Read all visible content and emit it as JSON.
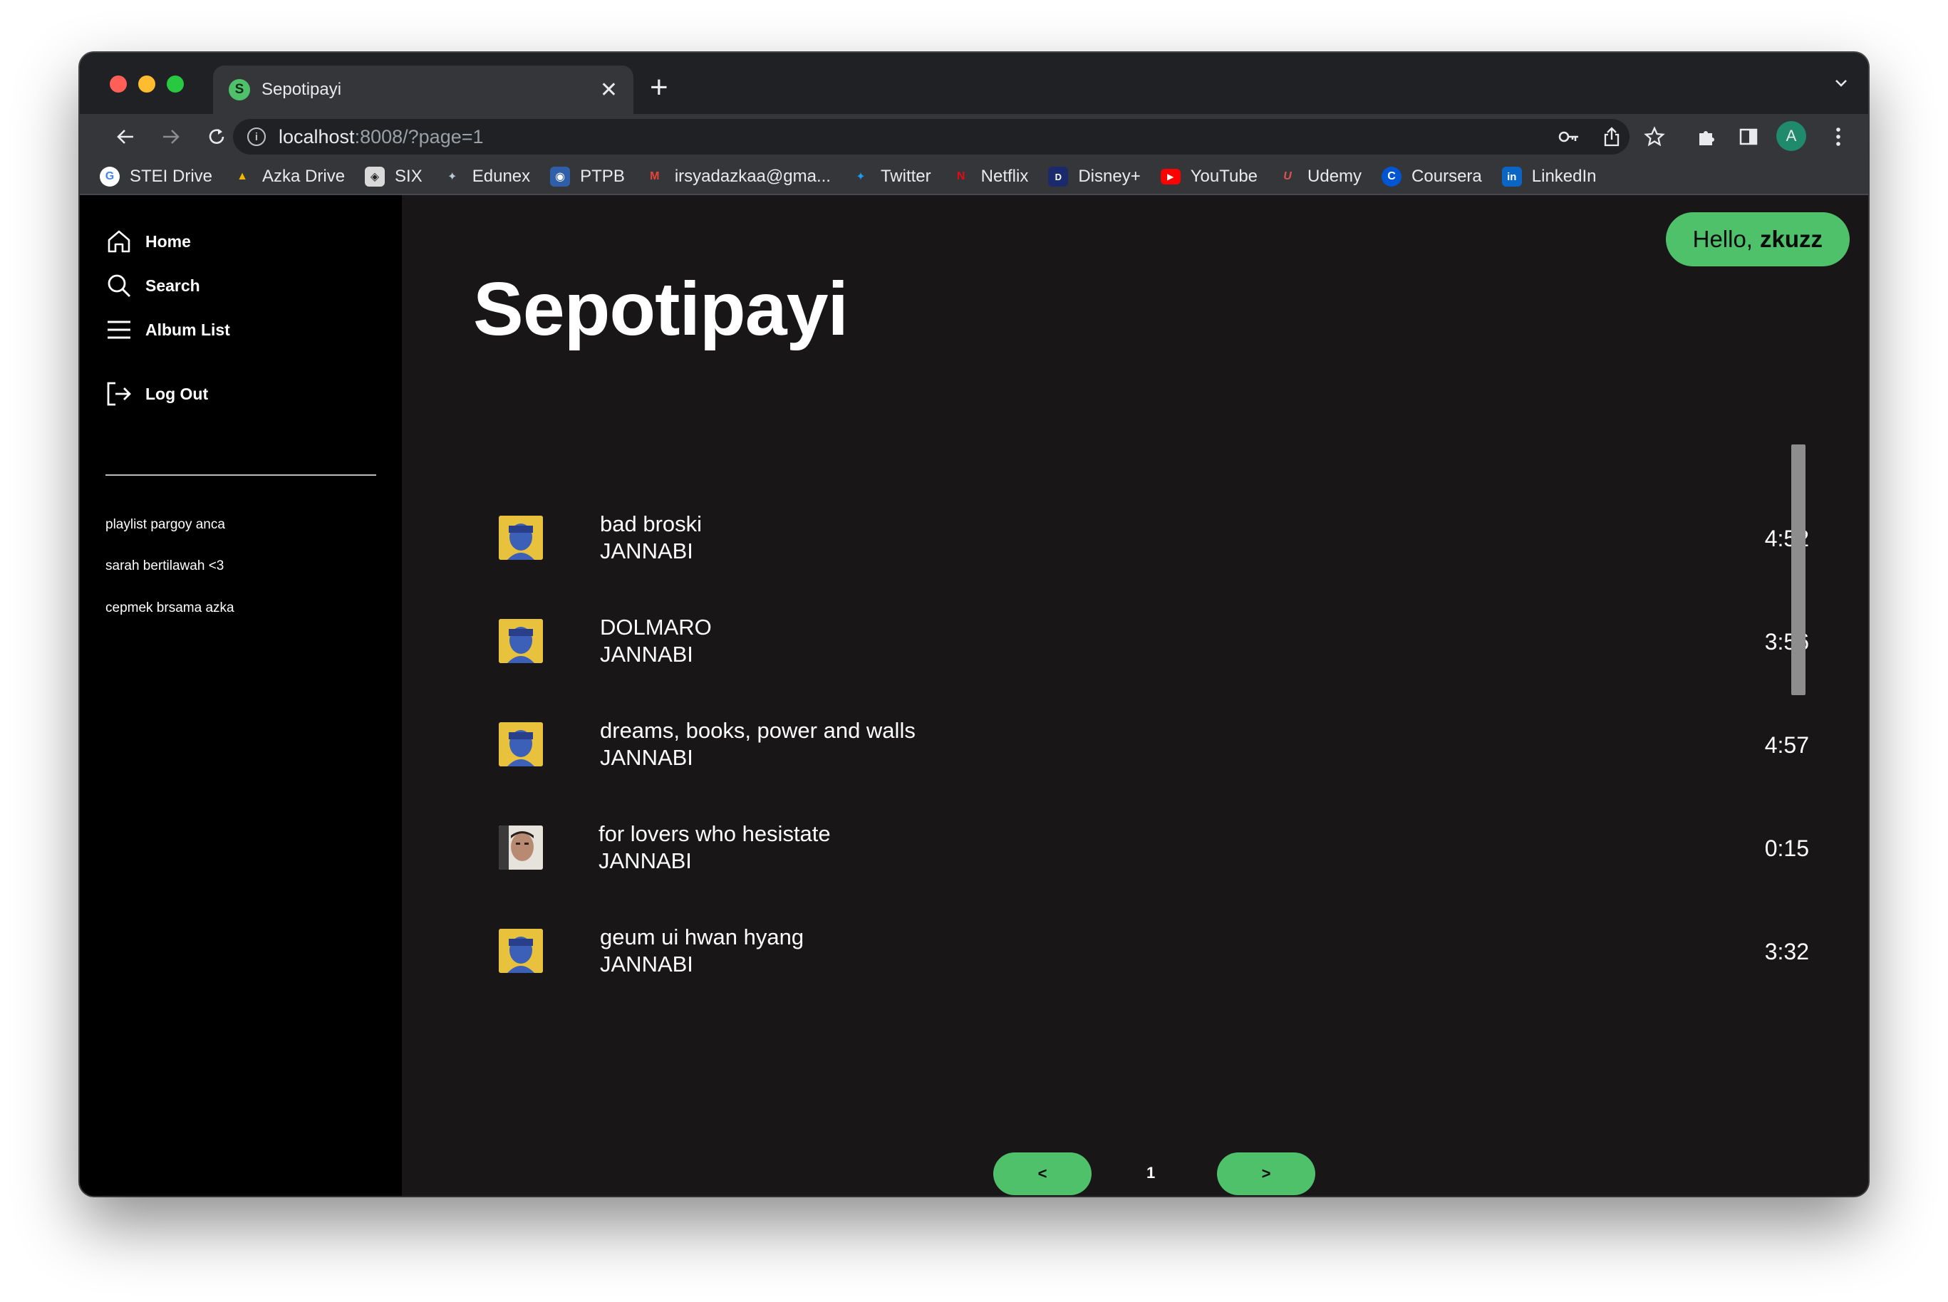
{
  "browser": {
    "tab_title": "Sepotipayi",
    "tab_favicon_letter": "S",
    "tab_close": "✕",
    "new_tab": "+",
    "url_host": "localhost",
    "url_rest": ":8008/?page=1",
    "profile_letter": "A",
    "bookmarks": [
      {
        "label": "STEI Drive",
        "icon": "google-icon",
        "color": "#4285f4",
        "glyph": "G"
      },
      {
        "label": "Azka Drive",
        "icon": "google-drive-icon",
        "color": "#1fa463",
        "glyph": "▲"
      },
      {
        "label": "SIX",
        "icon": "six-icon",
        "color": "#9e9e9e",
        "glyph": "◈"
      },
      {
        "label": "Edunex",
        "icon": "edunex-icon",
        "color": "#6a8caf",
        "glyph": "✦"
      },
      {
        "label": "PTPB",
        "icon": "ptpb-icon",
        "color": "#2f5fa8",
        "glyph": "◉"
      },
      {
        "label": "irsyadazkaa@gma...",
        "icon": "gmail-icon",
        "color": "#ea4335",
        "glyph": "M"
      },
      {
        "label": "Twitter",
        "icon": "twitter-icon",
        "color": "#1d9bf0",
        "glyph": "✦"
      },
      {
        "label": "Netflix",
        "icon": "netflix-icon",
        "color": "#e50914",
        "glyph": "N"
      },
      {
        "label": "Disney+",
        "icon": "disney-icon",
        "color": "#1a2a6c",
        "glyph": "D"
      },
      {
        "label": "YouTube",
        "icon": "youtube-icon",
        "color": "#ff0000",
        "glyph": "▶"
      },
      {
        "label": "Udemy",
        "icon": "udemy-icon",
        "color": "#a435f0",
        "glyph": "U"
      },
      {
        "label": "Coursera",
        "icon": "coursera-icon",
        "color": "#0056d2",
        "glyph": "C"
      },
      {
        "label": "LinkedIn",
        "icon": "linkedin-icon",
        "color": "#0a66c2",
        "glyph": "in"
      }
    ]
  },
  "sidebar": {
    "nav": [
      {
        "label": "Home",
        "icon": "home-icon"
      },
      {
        "label": "Search",
        "icon": "search-icon"
      },
      {
        "label": "Album List",
        "icon": "menu-icon"
      },
      {
        "label": "Log Out",
        "icon": "logout-icon"
      }
    ],
    "playlists": [
      "playlist pargoy anca",
      "sarah bertilawah <3",
      "cepmek brsama azka"
    ]
  },
  "header": {
    "greeting": "Hello,",
    "username": "zkuzz",
    "title": "Sepotipayi"
  },
  "songs": [
    {
      "title": "bad broski",
      "artist": "JANNABI",
      "duration": "4:52",
      "thumb": "album-art-jannabi"
    },
    {
      "title": "DOLMARO",
      "artist": "JANNABI",
      "duration": "3:56",
      "thumb": "album-art-jannabi"
    },
    {
      "title": "dreams, books, power and walls",
      "artist": "JANNABI",
      "duration": "4:57",
      "thumb": "album-art-jannabi"
    },
    {
      "title": "for lovers who hesistate",
      "artist": "JANNABI",
      "duration": "0:15",
      "thumb": "album-art-photo"
    },
    {
      "title": "geum ui hwan hyang",
      "artist": "JANNABI",
      "duration": "3:32",
      "thumb": "album-art-jannabi"
    }
  ],
  "pagination": {
    "prev": "<",
    "current": "1",
    "next": ">"
  },
  "colors": {
    "accent": "#4ec16a",
    "main_bg": "#181616",
    "sidebar_bg": "#000000"
  }
}
